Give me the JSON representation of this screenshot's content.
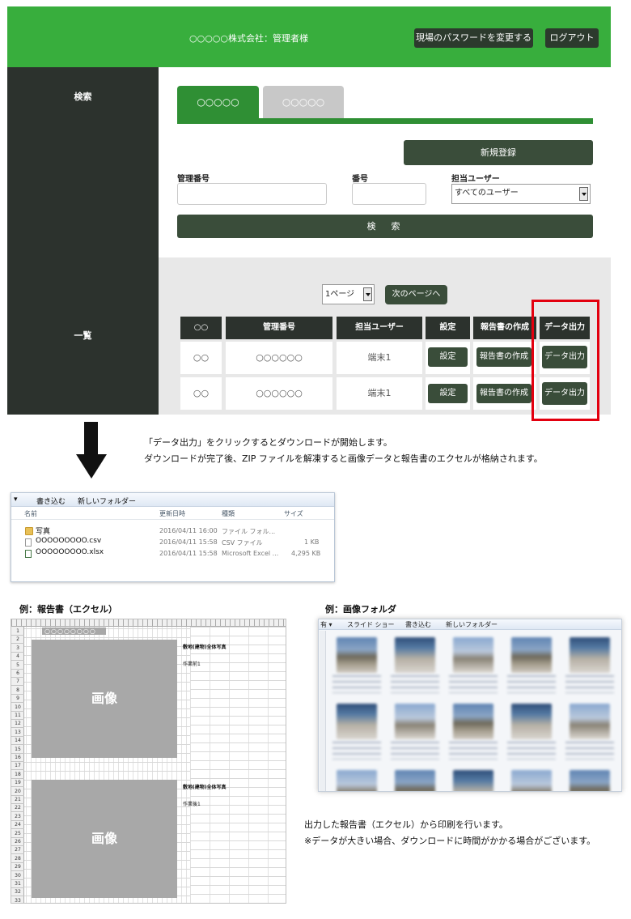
{
  "header": {
    "company": "○○○○○株式会社：管理者様",
    "change_password": "現場のパスワードを変更する",
    "logout": "ログアウト"
  },
  "search": {
    "side_label": "検索",
    "tab_active": "○○○○○",
    "tab_inactive": "○○○○○",
    "new_button": "新規登録",
    "label_id": "管理番号",
    "label_number": "番号",
    "label_user": "担当ユーザー",
    "user_select_value": "すべてのユーザー",
    "search_button": "検　索"
  },
  "list": {
    "side_label": "一覧",
    "page_select_value": "1ページ",
    "next_page": "次のページへ",
    "columns": [
      "○○",
      "管理番号",
      "担当ユーザー",
      "設定",
      "報告書の作成",
      "データ出力"
    ],
    "rows": [
      {
        "c1": "○○",
        "id": "○○○○○○",
        "user": "端末1",
        "settings": "設定",
        "report": "報告書の作成",
        "export": "データ出力"
      },
      {
        "c1": "○○",
        "id": "○○○○○○",
        "user": "端末1",
        "settings": "設定",
        "report": "報告書の作成",
        "export": "データ出力"
      }
    ]
  },
  "instructions": {
    "line1": "「データ出力」をクリックするとダウンロードが開始します。",
    "line2": "ダウンロードが完了後、ZIP ファイルを解凍すると画像データと報告書のエクセルが格納されます。"
  },
  "explorer": {
    "toolbar": [
      "▾",
      "書き込む",
      "新しいフォルダー"
    ],
    "headers": {
      "name": "名前",
      "date": "更新日時",
      "type": "種類",
      "size": "サイズ"
    },
    "files": [
      {
        "name": "写真",
        "date": "2016/04/11 16:00",
        "type": "ファイル フォル...",
        "size": "",
        "icon": "folder-icon"
      },
      {
        "name": "OOOOOOOOO.csv",
        "date": "2016/04/11 15:58",
        "type": "CSV ファイル",
        "size": "1 KB",
        "icon": "csv-file-icon"
      },
      {
        "name": "OOOOOOOOO.xlsx",
        "date": "2016/04/11 15:58",
        "type": "Microsoft Excel ...",
        "size": "4,295 KB",
        "icon": "excel-file-icon"
      }
    ]
  },
  "excel_sample": {
    "title": "例：報告書（エクセル）",
    "top_cell": "○○○○○○○○",
    "image_label": "画像",
    "block_label": "敷地(建物)全体写真",
    "sub_label": "作業前1",
    "sub_label_2": "作業後1",
    "row_numbers": [
      "1",
      "2",
      "3",
      "4",
      "5",
      "6",
      "7",
      "8",
      "9",
      "10",
      "11",
      "12",
      "13",
      "14",
      "15",
      "16",
      "17",
      "18",
      "19",
      "20",
      "21",
      "22",
      "23",
      "24",
      "25",
      "26",
      "27",
      "28",
      "29",
      "30",
      "31",
      "32",
      "33"
    ]
  },
  "image_folder_sample": {
    "title": "例：画像フォルダ",
    "toolbar": [
      "有 ▾",
      "スライド ショー",
      "書き込む",
      "新しいフォルダー"
    ]
  },
  "notes": {
    "line1": "出力した報告書（エクセル）から印刷を行います。",
    "line2": "※データが大きい場合、ダウンロードに時間がかかる場合がございます。"
  },
  "colors": {
    "header_green": "#38ae3d",
    "tab_green": "#2f8f34",
    "sidebar_dark": "#2c322d",
    "button_dark_green": "#3a4d3a",
    "highlight_red": "#e3000f"
  }
}
